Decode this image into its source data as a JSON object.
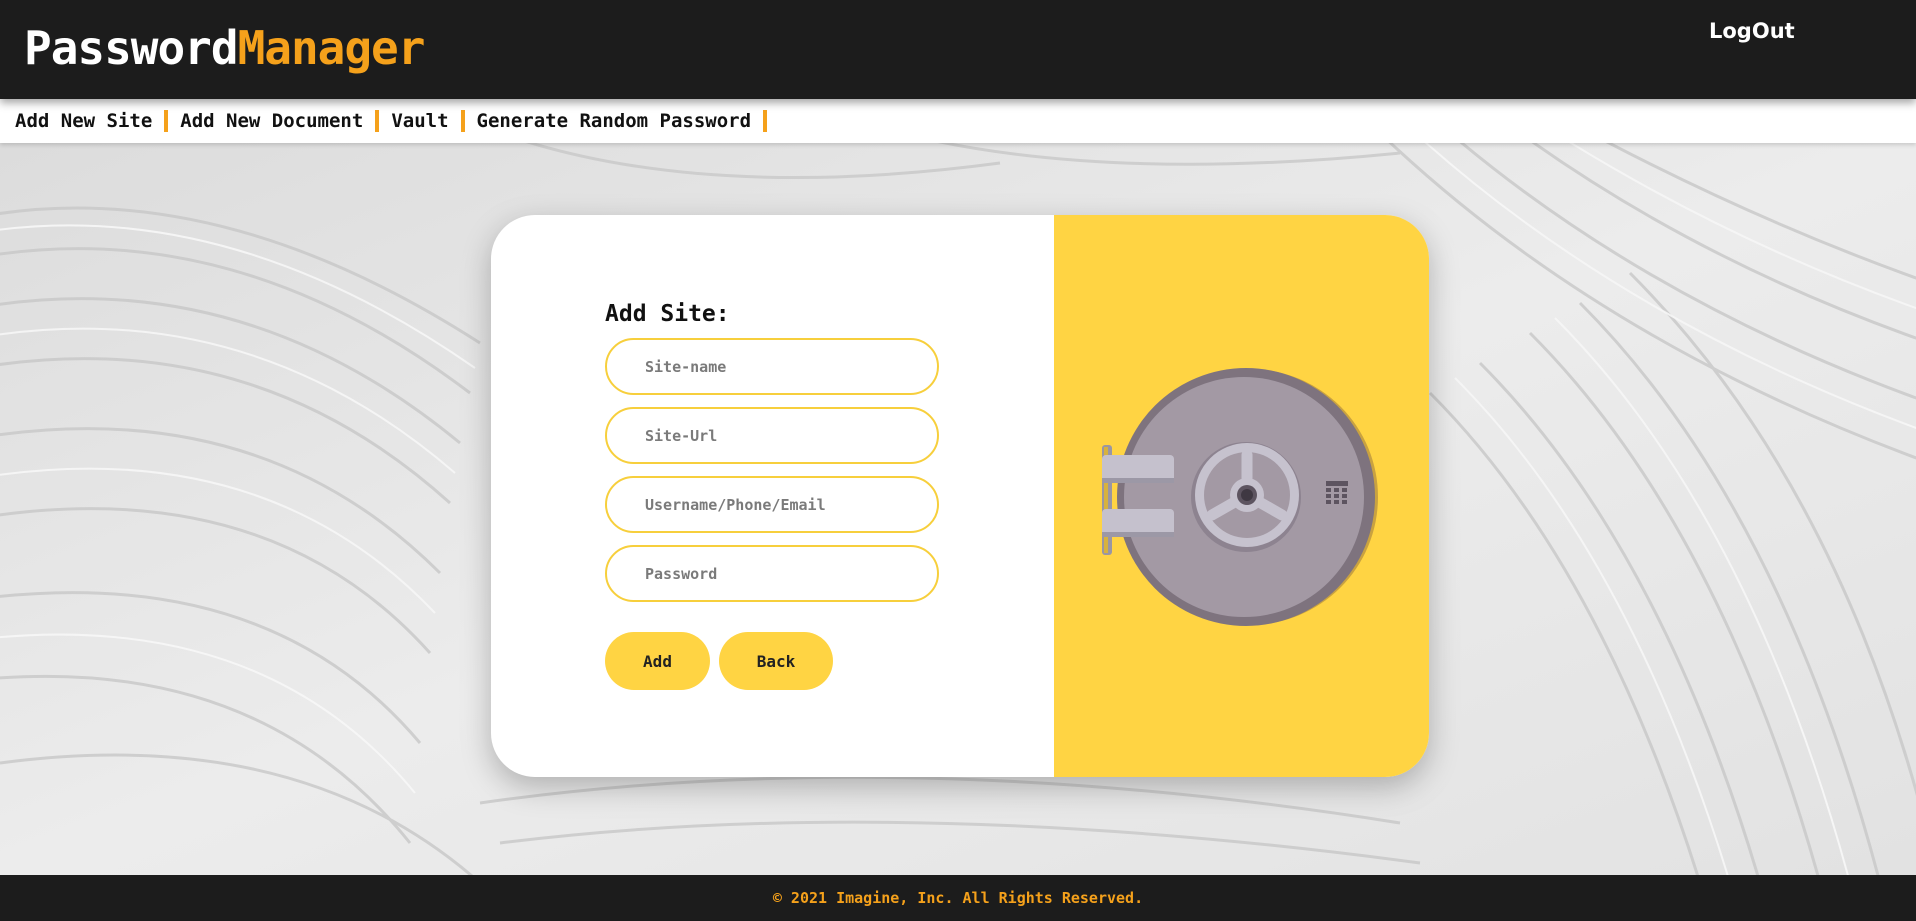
{
  "header": {
    "logo_part1": "Password",
    "logo_part2": "Manager",
    "logout_label": "LogOut"
  },
  "nav": {
    "items": [
      {
        "label": "Add New Site"
      },
      {
        "label": "Add New Document"
      },
      {
        "label": "Vault"
      },
      {
        "label": "Generate Random Password"
      }
    ]
  },
  "form": {
    "title": "Add Site:",
    "fields": [
      {
        "placeholder": "Site-name",
        "value": ""
      },
      {
        "placeholder": "Site-Url",
        "value": ""
      },
      {
        "placeholder": "Username/Phone/Email",
        "value": ""
      },
      {
        "placeholder": "Password",
        "value": ""
      }
    ],
    "add_label": "Add",
    "back_label": "Back"
  },
  "illustration": {
    "icon": "vault-door-icon"
  },
  "footer": {
    "copyright": "© 2021 Imagine, Inc. All Rights Reserved."
  },
  "colors": {
    "header_bg": "#1c1c1c",
    "accent_orange": "#f5a11b",
    "accent_yellow": "#ffd443",
    "field_border": "#f7cf3c"
  }
}
